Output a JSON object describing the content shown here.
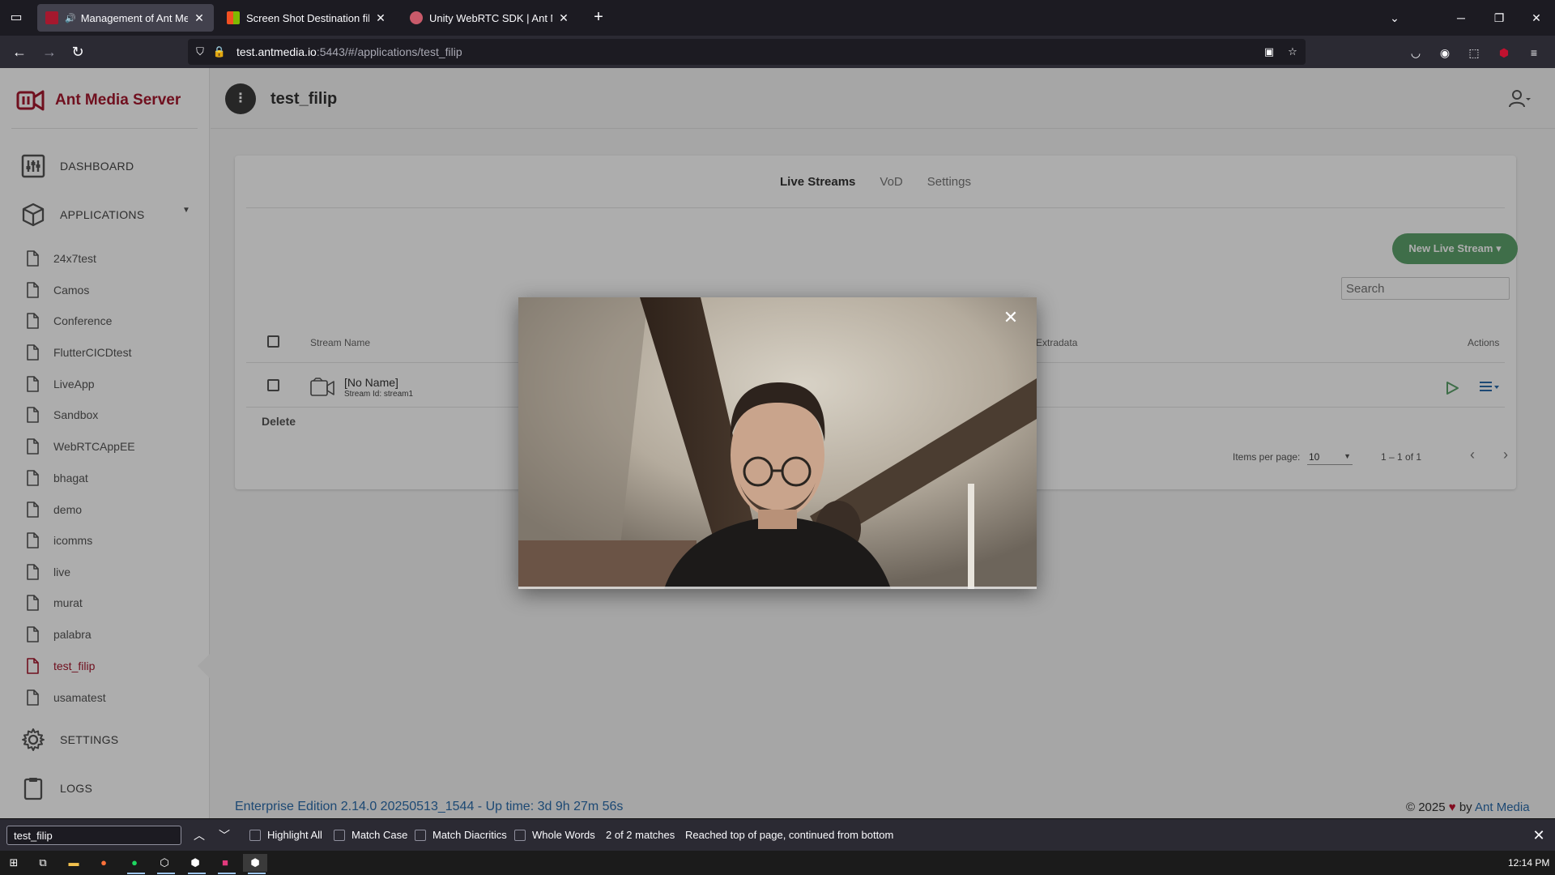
{
  "browser": {
    "tabs": [
      {
        "title": "Management of Ant Media",
        "active": true,
        "favicon_color": "#a5182e"
      },
      {
        "title": "Screen Shot Destination file Ch",
        "active": false,
        "favicon_color": "#f25022"
      },
      {
        "title": "Unity WebRTC SDK | Ant Media",
        "active": false,
        "favicon_color": "#c95a6a"
      }
    ],
    "url_host": "test.antmedia.io",
    "url_rest": ":5443/#/applications/test_filip"
  },
  "sidebar": {
    "brand": "Ant Media Server",
    "dashboard": "DASHBOARD",
    "applications": "APPLICATIONS",
    "apps": [
      "24x7test",
      "Camos",
      "Conference",
      "FlutterCICDtest",
      "LiveApp",
      "Sandbox",
      "WebRTCAppEE",
      "bhagat",
      "demo",
      "icomms",
      "live",
      "murat",
      "palabra",
      "test_filip",
      "usamatest"
    ],
    "active_app": "test_filip",
    "settings": "SETTINGS",
    "logs": "LOGS"
  },
  "header": {
    "menu_glyph": "⋮",
    "title": "test_filip"
  },
  "content": {
    "tabs": [
      "Live Streams",
      "VoD",
      "Settings"
    ],
    "active_tab": "Live Streams",
    "new_button": "New Live Stream ▾",
    "search_placeholder": "Search",
    "columns": {
      "stream_name": "Stream Name",
      "extradata": "Extradata",
      "actions": "Actions"
    },
    "rows": [
      {
        "name": "[No Name]",
        "stream_id": "Stream Id: stream1"
      }
    ],
    "delete_label": "Delete",
    "items_per_page_label": "Items per page:",
    "items_per_page_value": "10",
    "range_label": "1 – 1 of 1"
  },
  "footer": {
    "left": "Enterprise Edition 2.14.0 20250513_1544  -  Up time: 3d 9h 27m 56s",
    "copyright": "© 2025",
    "heart": "♥",
    "by": "by",
    "link": "Ant Media"
  },
  "findbar": {
    "query": "test_filip",
    "highlight_all": "Highlight All",
    "match_case": "Match Case",
    "match_diacritics": "Match Diacritics",
    "whole_words": "Whole Words",
    "match_count": "2 of 2 matches",
    "status": "Reached top of page, continued from bottom"
  },
  "taskbar": {
    "clock": "12:14 PM"
  },
  "colors": {
    "brand": "#a5182e",
    "accent_green": "#5ea26c",
    "link_blue": "#2b6cab"
  }
}
